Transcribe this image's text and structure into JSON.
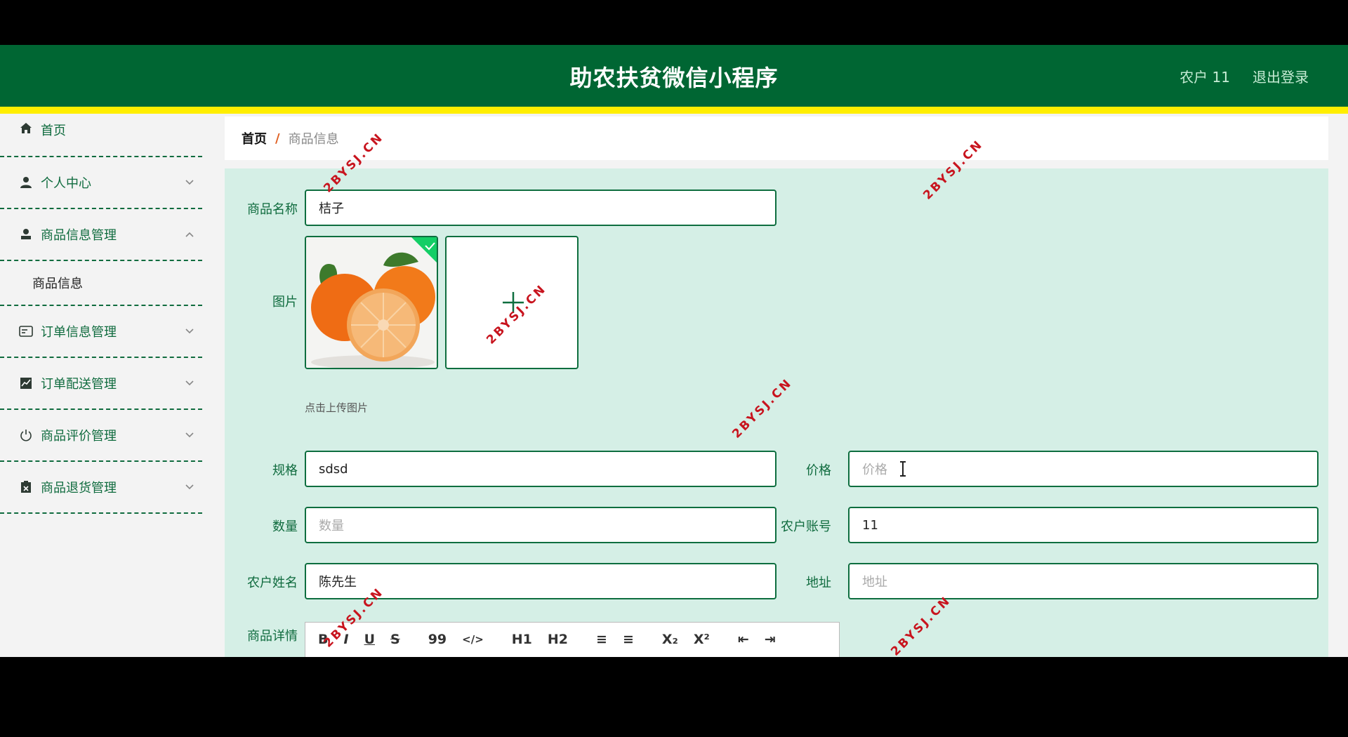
{
  "header": {
    "title": "助农扶贫微信小程序",
    "user": "农户 11",
    "logout": "退出登录"
  },
  "sidebar": {
    "items": [
      {
        "label": "首页",
        "icon": "home-icon"
      },
      {
        "label": "个人中心",
        "icon": "user-icon"
      },
      {
        "label": "商品信息管理",
        "icon": "user-icon",
        "expanded": true
      },
      {
        "label": "订单信息管理",
        "icon": "card-icon"
      },
      {
        "label": "订单配送管理",
        "icon": "chart-icon"
      },
      {
        "label": "商品评价管理",
        "icon": "power-icon"
      },
      {
        "label": "商品退货管理",
        "icon": "clipboard-icon"
      }
    ],
    "submenu": [
      "商品信息"
    ]
  },
  "breadcrumb": {
    "home": "首页",
    "separator": "/",
    "current": "商品信息"
  },
  "form": {
    "name_label": "商品名称",
    "name_value": "桔子",
    "image_label": "图片",
    "upload_hint": "点击上传图片",
    "spec_label": "规格",
    "spec_value": "sdsd",
    "price_label": "价格",
    "price_placeholder": "价格",
    "qty_label": "数量",
    "qty_placeholder": "数量",
    "account_label": "农户账号",
    "account_value": "11",
    "farmer_label": "农户姓名",
    "farmer_value": "陈先生",
    "address_label": "地址",
    "address_placeholder": "地址",
    "detail_label": "商品详情"
  },
  "editor_toolbar": [
    "B",
    "I",
    "U",
    "S",
    "99",
    "</>",
    "H1",
    "H2",
    "≡",
    "≡",
    "X₂",
    "X²",
    "⇤",
    "⇥"
  ],
  "watermark": "2BYSJ.CN",
  "colors": {
    "header": "#006633",
    "stripe": "#ffee00",
    "panel": "#d5efe6",
    "accent": "#0f6b3e"
  }
}
